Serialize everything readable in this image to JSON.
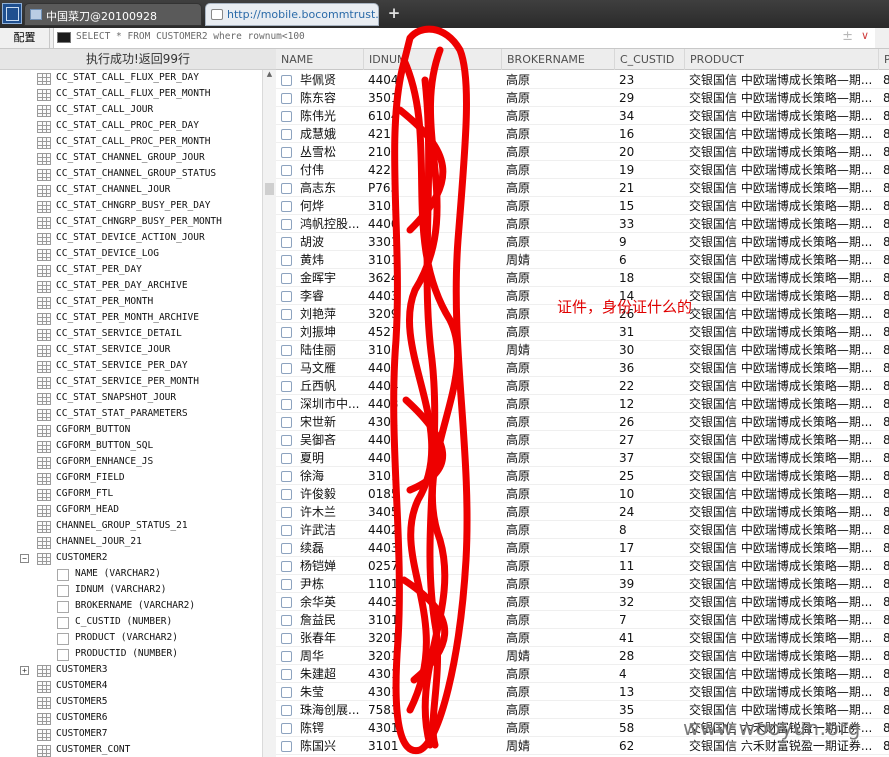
{
  "tabs": [
    {
      "label": "中国菜刀@20100928",
      "active": false,
      "icon": "window-icon"
    },
    {
      "label": "http://mobile.bocommtrust.co...",
      "active": true,
      "icon": "page-icon"
    }
  ],
  "toolbar": {
    "config_label": "配置",
    "sql": "SELECT * FROM CUSTOMER2 where rownum<100",
    "clear_symbol": "±",
    "dropdown_symbol": "∨"
  },
  "status": "执行成功!返回99行",
  "tree": [
    {
      "kind": "table",
      "label": "CC_STAT_CALL_FLUX_PER_DAY"
    },
    {
      "kind": "table",
      "label": "CC_STAT_CALL_FLUX_PER_MONTH"
    },
    {
      "kind": "table",
      "label": "CC_STAT_CALL_JOUR"
    },
    {
      "kind": "table",
      "label": "CC_STAT_CALL_PROC_PER_DAY"
    },
    {
      "kind": "table",
      "label": "CC_STAT_CALL_PROC_PER_MONTH"
    },
    {
      "kind": "table",
      "label": "CC_STAT_CHANNEL_GROUP_JOUR"
    },
    {
      "kind": "table",
      "label": "CC_STAT_CHANNEL_GROUP_STATUS"
    },
    {
      "kind": "table",
      "label": "CC_STAT_CHANNEL_JOUR"
    },
    {
      "kind": "table",
      "label": "CC_STAT_CHNGRP_BUSY_PER_DAY"
    },
    {
      "kind": "table",
      "label": "CC_STAT_CHNGRP_BUSY_PER_MONTH"
    },
    {
      "kind": "table",
      "label": "CC_STAT_DEVICE_ACTION_JOUR"
    },
    {
      "kind": "table",
      "label": "CC_STAT_DEVICE_LOG"
    },
    {
      "kind": "table",
      "label": "CC_STAT_PER_DAY"
    },
    {
      "kind": "table",
      "label": "CC_STAT_PER_DAY_ARCHIVE"
    },
    {
      "kind": "table",
      "label": "CC_STAT_PER_MONTH"
    },
    {
      "kind": "table",
      "label": "CC_STAT_PER_MONTH_ARCHIVE"
    },
    {
      "kind": "table",
      "label": "CC_STAT_SERVICE_DETAIL"
    },
    {
      "kind": "table",
      "label": "CC_STAT_SERVICE_JOUR"
    },
    {
      "kind": "table",
      "label": "CC_STAT_SERVICE_PER_DAY"
    },
    {
      "kind": "table",
      "label": "CC_STAT_SERVICE_PER_MONTH"
    },
    {
      "kind": "table",
      "label": "CC_STAT_SNAPSHOT_JOUR"
    },
    {
      "kind": "table",
      "label": "CC_STAT_STAT_PARAMETERS"
    },
    {
      "kind": "table",
      "label": "CGFORM_BUTTON"
    },
    {
      "kind": "table",
      "label": "CGFORM_BUTTON_SQL"
    },
    {
      "kind": "table",
      "label": "CGFORM_ENHANCE_JS"
    },
    {
      "kind": "table",
      "label": "CGFORM_FIELD"
    },
    {
      "kind": "table",
      "label": "CGFORM_FTL"
    },
    {
      "kind": "table",
      "label": "CGFORM_HEAD"
    },
    {
      "kind": "table",
      "label": "CHANNEL_GROUP_STATUS_21"
    },
    {
      "kind": "table",
      "label": "CHANNEL_JOUR_21"
    },
    {
      "kind": "table",
      "label": "CUSTOMER2",
      "toggle": "−"
    },
    {
      "kind": "column",
      "label": "NAME (VARCHAR2)"
    },
    {
      "kind": "column",
      "label": "IDNUM (VARCHAR2)"
    },
    {
      "kind": "column",
      "label": "BROKERNAME (VARCHAR2)"
    },
    {
      "kind": "column",
      "label": "C_CUSTID (NUMBER)"
    },
    {
      "kind": "column",
      "label": "PRODUCT (VARCHAR2)"
    },
    {
      "kind": "column",
      "label": "PRODUCTID (NUMBER)"
    },
    {
      "kind": "table",
      "label": "CUSTOMER3",
      "toggle": "+"
    },
    {
      "kind": "table",
      "label": "CUSTOMER4"
    },
    {
      "kind": "table",
      "label": "CUSTOMER5"
    },
    {
      "kind": "table",
      "label": "CUSTOMER6"
    },
    {
      "kind": "table",
      "label": "CUSTOMER7"
    },
    {
      "kind": "table",
      "label": "CUSTOMER_CONT"
    }
  ],
  "grid": {
    "columns": [
      "NAME",
      "IDNUM",
      "BROKERNAME",
      "C_CUSTID",
      "PRODUCT",
      "P"
    ],
    "rows": [
      [
        "毕佩贤",
        "4404",
        "高原",
        "23",
        "交银国信 中欧瑞博成长策略—期...",
        "8"
      ],
      [
        "陈东容",
        "3501",
        "高原",
        "29",
        "交银国信 中欧瑞博成长策略—期...",
        "8"
      ],
      [
        "陈伟光",
        "6104",
        "高原",
        "34",
        "交银国信 中欧瑞博成长策略—期...",
        "8"
      ],
      [
        "成慧娥",
        "4211",
        "高原",
        "16",
        "交银国信 中欧瑞博成长策略—期...",
        "8"
      ],
      [
        "丛雪松",
        "2101",
        "高原",
        "20",
        "交银国信 中欧瑞博成长策略—期...",
        "8"
      ],
      [
        "付伟",
        "4227",
        "高原",
        "19",
        "交银国信 中欧瑞博成长策略—期...",
        "8"
      ],
      [
        "高志东",
        "P763",
        "高原",
        "21",
        "交银国信 中欧瑞博成长策略—期...",
        "8"
      ],
      [
        "何烨",
        "3101",
        "高原",
        "15",
        "交银国信 中欧瑞博成长策略—期...",
        "8"
      ],
      [
        "鸿帆控股...",
        "4400",
        "高原",
        "33",
        "交银国信 中欧瑞博成长策略—期...",
        "8"
      ],
      [
        "胡波",
        "3301",
        "高原",
        "9",
        "交银国信 中欧瑞博成长策略—期...",
        "8"
      ],
      [
        "黄炜",
        "3101",
        "周婧",
        "6",
        "交银国信 中欧瑞博成长策略—期...",
        "8"
      ],
      [
        "金晖宇",
        "3624",
        "高原",
        "18",
        "交银国信 中欧瑞博成长策略—期...",
        "8"
      ],
      [
        "李睿",
        "4403",
        "高原",
        "14",
        "交银国信 中欧瑞博成长策略—期...",
        "8"
      ],
      [
        "刘艳萍",
        "3209",
        "高原",
        "26",
        "交银国信 中欧瑞博成长策略—期...",
        "8"
      ],
      [
        "刘振坤",
        "4527",
        "高原",
        "31",
        "交银国信 中欧瑞博成长策略—期...",
        "8"
      ],
      [
        "陆佳丽",
        "3101",
        "周婧",
        "30",
        "交银国信 中欧瑞博成长策略—期...",
        "8"
      ],
      [
        "马文雁",
        "4403",
        "高原",
        "36",
        "交银国信 中欧瑞博成长策略—期...",
        "8"
      ],
      [
        "丘西帆",
        "4404",
        "高原",
        "22",
        "交银国信 中欧瑞博成长策略—期...",
        "8"
      ],
      [
        "深圳市中...",
        "4403",
        "高原",
        "12",
        "交银国信 中欧瑞博成长策略—期...",
        "8"
      ],
      [
        "宋世新",
        "4301",
        "高原",
        "26",
        "交银国信 中欧瑞博成长策略—期...",
        "8"
      ],
      [
        "吴御吝",
        "4405",
        "高原",
        "27",
        "交银国信 中欧瑞博成长策略—期...",
        "8"
      ],
      [
        "夏明",
        "4403",
        "高原",
        "37",
        "交银国信 中欧瑞博成长策略—期...",
        "8"
      ],
      [
        "徐海",
        "3101",
        "高原",
        "25",
        "交银国信 中欧瑞博成长策略—期...",
        "8"
      ],
      [
        "许俊毅",
        "0185",
        "高原",
        "10",
        "交银国信 中欧瑞博成长策略—期...",
        "8"
      ],
      [
        "许木兰",
        "3405",
        "高原",
        "24",
        "交银国信 中欧瑞博成长策略—期...",
        "8"
      ],
      [
        "许武洁",
        "4402",
        "高原",
        "8",
        "交银国信 中欧瑞博成长策略—期...",
        "8"
      ],
      [
        "续磊",
        "4403",
        "高原",
        "17",
        "交银国信 中欧瑞博成长策略—期...",
        "8"
      ],
      [
        "杨铠婵",
        "0257",
        "高原",
        "11",
        "交银国信 中欧瑞博成长策略—期...",
        "8"
      ],
      [
        "尹栋",
        "1101",
        "高原",
        "39",
        "交银国信 中欧瑞博成长策略—期...",
        "8"
      ],
      [
        "余华英",
        "4403",
        "高原",
        "32",
        "交银国信 中欧瑞博成长策略—期...",
        "8"
      ],
      [
        "詹益民",
        "3101",
        "高原",
        "7",
        "交银国信 中欧瑞博成长策略—期...",
        "8"
      ],
      [
        "张春年",
        "3201",
        "高原",
        "41",
        "交银国信 中欧瑞博成长策略—期...",
        "8"
      ],
      [
        "周华",
        "3201",
        "周婧",
        "28",
        "交银国信 中欧瑞博成长策略—期...",
        "8"
      ],
      [
        "朱建超",
        "4301",
        "高原",
        "4",
        "交银国信 中欧瑞博成长策略—期...",
        "8"
      ],
      [
        "朱莹",
        "4301",
        "高原",
        "13",
        "交银国信 中欧瑞博成长策略—期...",
        "8"
      ],
      [
        "珠海创展...",
        "7583",
        "高原",
        "35",
        "交银国信 中欧瑞博成长策略—期...",
        "8"
      ],
      [
        "陈锷",
        "4301",
        "高原",
        "58",
        "交银国信 六禾财富锐盈一期证券...",
        "8"
      ],
      [
        "陈国兴",
        "3101",
        "周婧",
        "62",
        "交银国信 六禾财富锐盈一期证券...",
        "8"
      ]
    ]
  },
  "annotation": "证件，身份证什么的",
  "watermark": "www.wooyun.org",
  "colors": {
    "scribble": "#ee0000",
    "annotation": "#e00000"
  }
}
